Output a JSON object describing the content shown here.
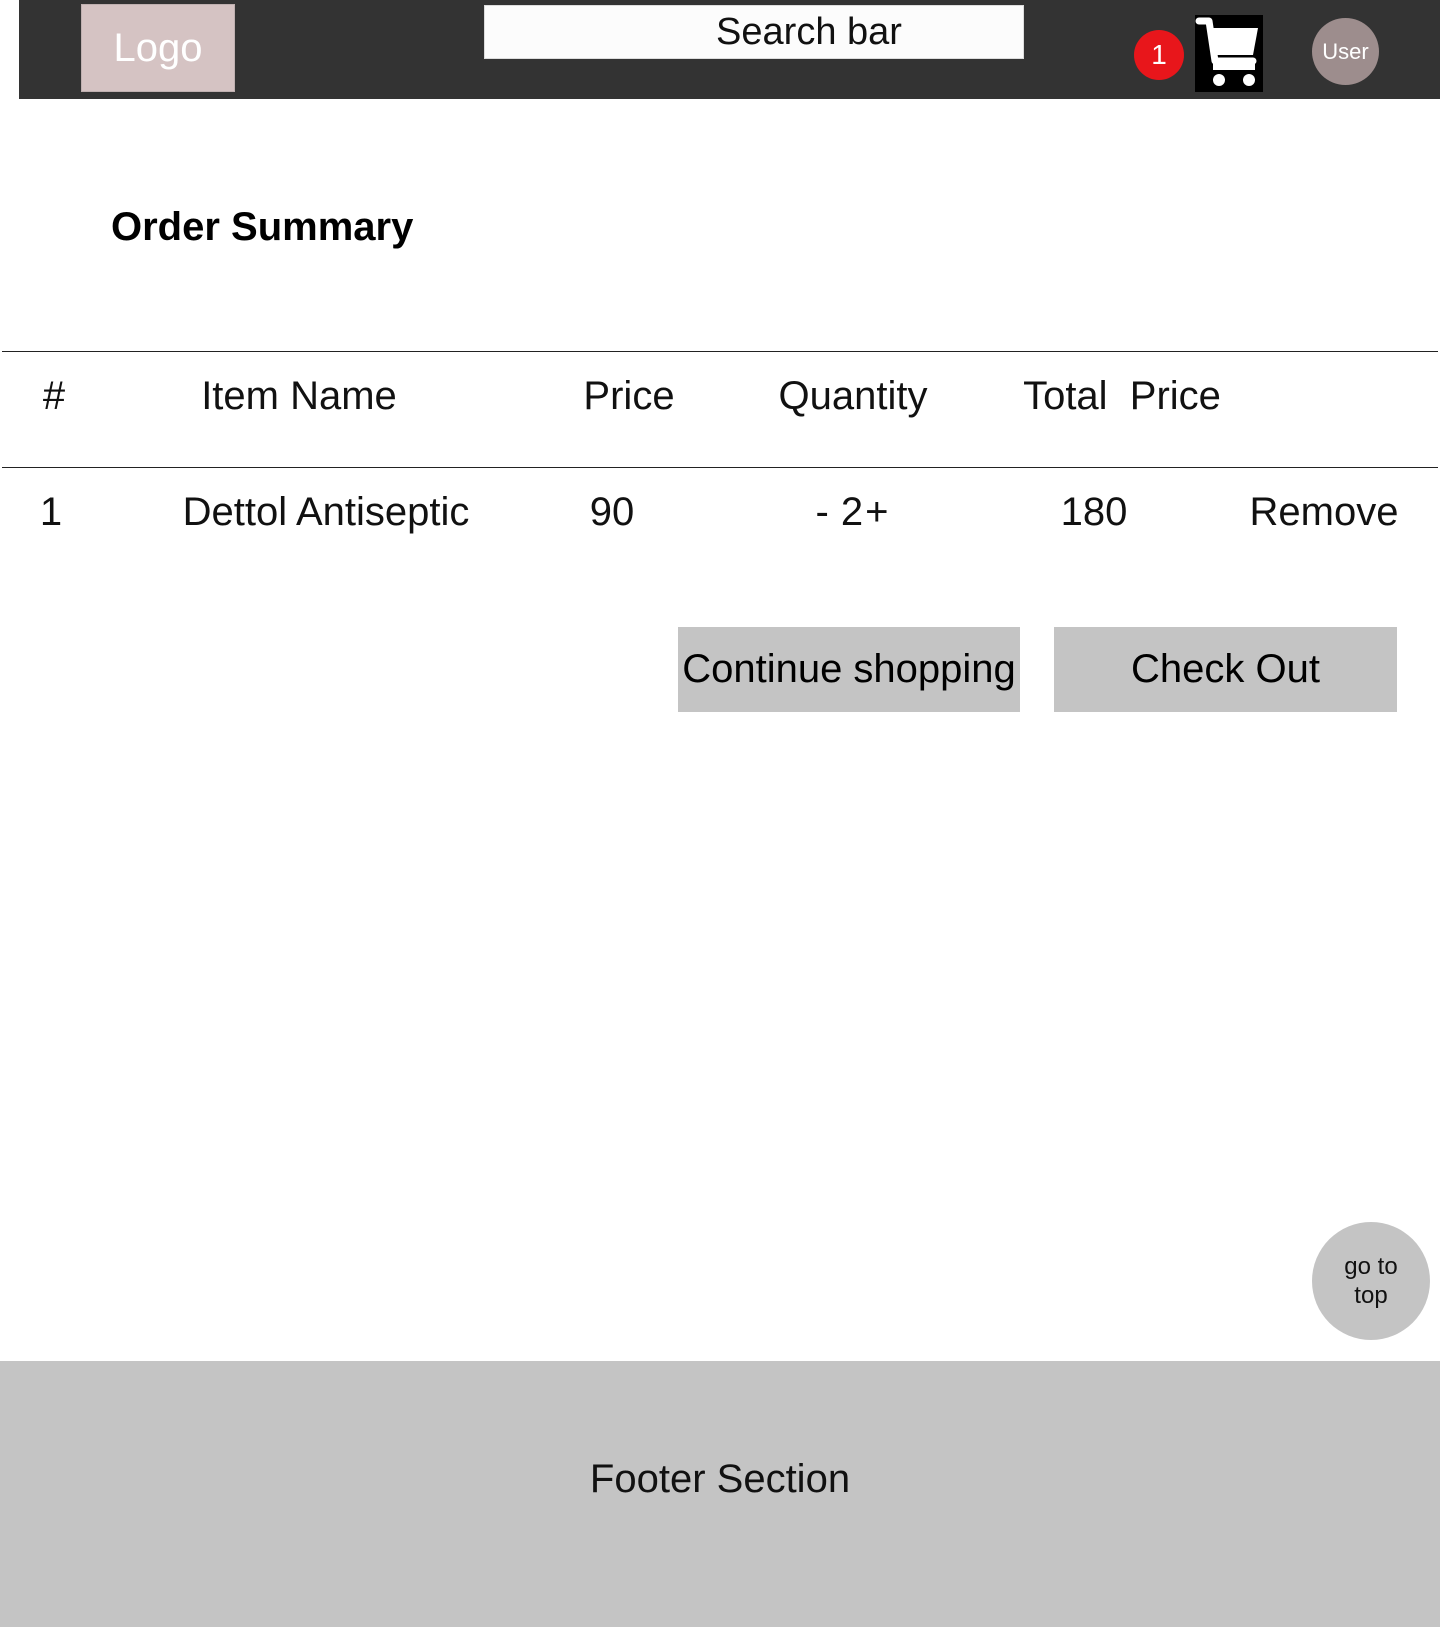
{
  "header": {
    "logo_label": "Logo",
    "search_placeholder": "Search bar",
    "cart_count": "1",
    "cart_icon": "cart-icon",
    "user_label": "User",
    "colors": {
      "background": "#333333",
      "logo": "#d5c3c3",
      "badge": "#e8161b",
      "user": "#9d8d8d"
    }
  },
  "main": {
    "title": "Order Summary",
    "table": {
      "columns": [
        "#",
        "Item Name",
        "Price",
        "Quantity",
        "Total  Price"
      ],
      "rows": [
        {
          "index": "1",
          "item_name": "Dettol Antiseptic",
          "price": "90",
          "quantity_decrement": "-",
          "quantity": "2",
          "quantity_increment": "+",
          "total_price": "180",
          "remove_label": "Remove"
        }
      ]
    },
    "buttons": {
      "continue_label": "Continue shopping",
      "checkout_label": "Check Out"
    },
    "go_top_line1": "go to",
    "go_top_line2": "top"
  },
  "footer": {
    "label": "Footer Section"
  }
}
